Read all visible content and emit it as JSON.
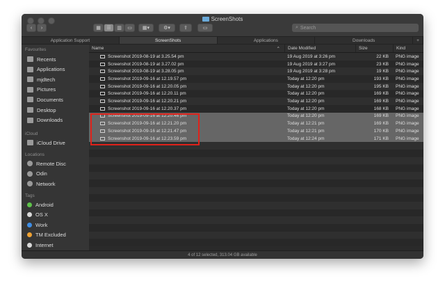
{
  "window": {
    "title": "ScreenShots"
  },
  "toolbar": {
    "search_placeholder": "Search"
  },
  "tabs": [
    {
      "label": "Application Support",
      "active": false
    },
    {
      "label": "ScreenShots",
      "active": true
    },
    {
      "label": "Applications",
      "active": false
    },
    {
      "label": "Downloads",
      "active": false
    }
  ],
  "sidebar": {
    "favourites_heading": "Favourites",
    "favourites": [
      "Recents",
      "Applications",
      "mjdtech",
      "Pictures",
      "Documents",
      "Desktop",
      "Downloads"
    ],
    "icloud_heading": "iCloud",
    "icloud": [
      "iCloud Drive"
    ],
    "locations_heading": "Locations",
    "locations": [
      "Remote Disc",
      "Odin",
      "Network"
    ],
    "tags_heading": "Tags",
    "tags": [
      {
        "label": "Android",
        "color": "#5ec34a"
      },
      {
        "label": "OS X",
        "color": "#d9d9d9"
      },
      {
        "label": "Work",
        "color": "#3e8ee6"
      },
      {
        "label": "TM Excluded",
        "color": "#f0a232"
      },
      {
        "label": "Internet",
        "color": "#d9d9d9"
      }
    ]
  },
  "columns": {
    "name": "Name",
    "date": "Date Modified",
    "size": "Size",
    "kind": "Kind"
  },
  "files": [
    {
      "name": "Screenshot 2019-08-19 at 3.25.54 pm",
      "date": "19 Aug 2019 at 3:26 pm",
      "size": "22 KB",
      "kind": "PNG image",
      "selected": false
    },
    {
      "name": "Screenshot 2019-08-19 at 3.27.02 pm",
      "date": "19 Aug 2019 at 3:27 pm",
      "size": "23 KB",
      "kind": "PNG image",
      "selected": false
    },
    {
      "name": "Screenshot 2019-08-19 at 3.28.05 pm",
      "date": "19 Aug 2019 at 3:28 pm",
      "size": "19 KB",
      "kind": "PNG image",
      "selected": false
    },
    {
      "name": "Screenshot 2019-09-16 at 12.19.57 pm",
      "date": "Today at 12:20 pm",
      "size": "193 KB",
      "kind": "PNG image",
      "selected": false
    },
    {
      "name": "Screenshot 2019-09-16 at 12.20.05 pm",
      "date": "Today at 12:20 pm",
      "size": "195 KB",
      "kind": "PNG image",
      "selected": false
    },
    {
      "name": "Screenshot 2019-09-16 at 12.20.11 pm",
      "date": "Today at 12:20 pm",
      "size": "169 KB",
      "kind": "PNG image",
      "selected": false
    },
    {
      "name": "Screenshot 2019-09-16 at 12.20.21 pm",
      "date": "Today at 12:20 pm",
      "size": "169 KB",
      "kind": "PNG image",
      "selected": false
    },
    {
      "name": "Screenshot 2019-09-16 at 12.20.37 pm",
      "date": "Today at 12:20 pm",
      "size": "168 KB",
      "kind": "PNG image",
      "selected": false
    },
    {
      "name": "Screenshot 2019-09-16 at 12.20.46 pm",
      "date": "Today at 12:20 pm",
      "size": "169 KB",
      "kind": "PNG image",
      "selected": true
    },
    {
      "name": "Screenshot 2019-09-16 at 12.21.20 pm",
      "date": "Today at 12:21 pm",
      "size": "169 KB",
      "kind": "PNG image",
      "selected": true
    },
    {
      "name": "Screenshot 2019-09-16 at 12.21.47 pm",
      "date": "Today at 12:21 pm",
      "size": "170 KB",
      "kind": "PNG image",
      "selected": true
    },
    {
      "name": "Screenshot 2019-09-16 at 12.23.59 pm",
      "date": "Today at 12:24 pm",
      "size": "171 KB",
      "kind": "PNG image",
      "selected": true
    }
  ],
  "status": "4 of 12 selected, 313.04 GB available"
}
